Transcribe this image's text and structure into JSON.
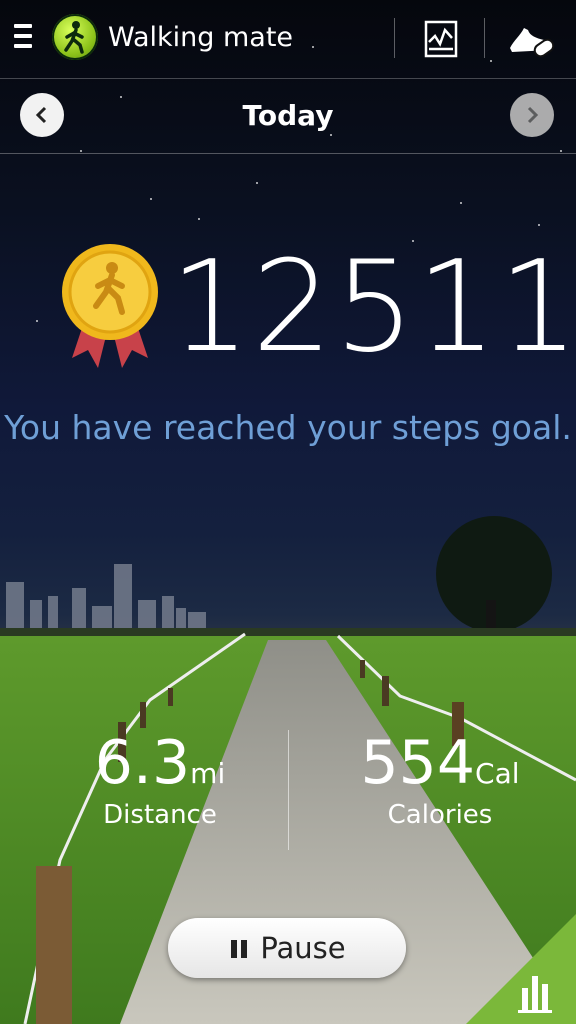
{
  "header": {
    "app_title": "Walking mate",
    "menu_icon": "menu-icon",
    "app_icon": "walker-icon",
    "actions": [
      "chart-icon",
      "shoe-icon"
    ]
  },
  "day_nav": {
    "label": "Today",
    "prev_icon": "chevron-left-icon",
    "next_icon": "chevron-right-icon"
  },
  "main": {
    "steps": "12511",
    "goal_message": "You have reached your steps goal.",
    "medal_icon": "medal-icon"
  },
  "stats": {
    "distance": {
      "value": "6.3",
      "unit": "mi",
      "label": "Distance"
    },
    "calories": {
      "value": "554",
      "unit": "Cal",
      "label": "Calories"
    }
  },
  "controls": {
    "pause_label": "Pause",
    "corner_icon": "bar-chart-icon"
  },
  "colors": {
    "goal_text": "#6f9fd6",
    "accent_green": "#7bb83a"
  }
}
